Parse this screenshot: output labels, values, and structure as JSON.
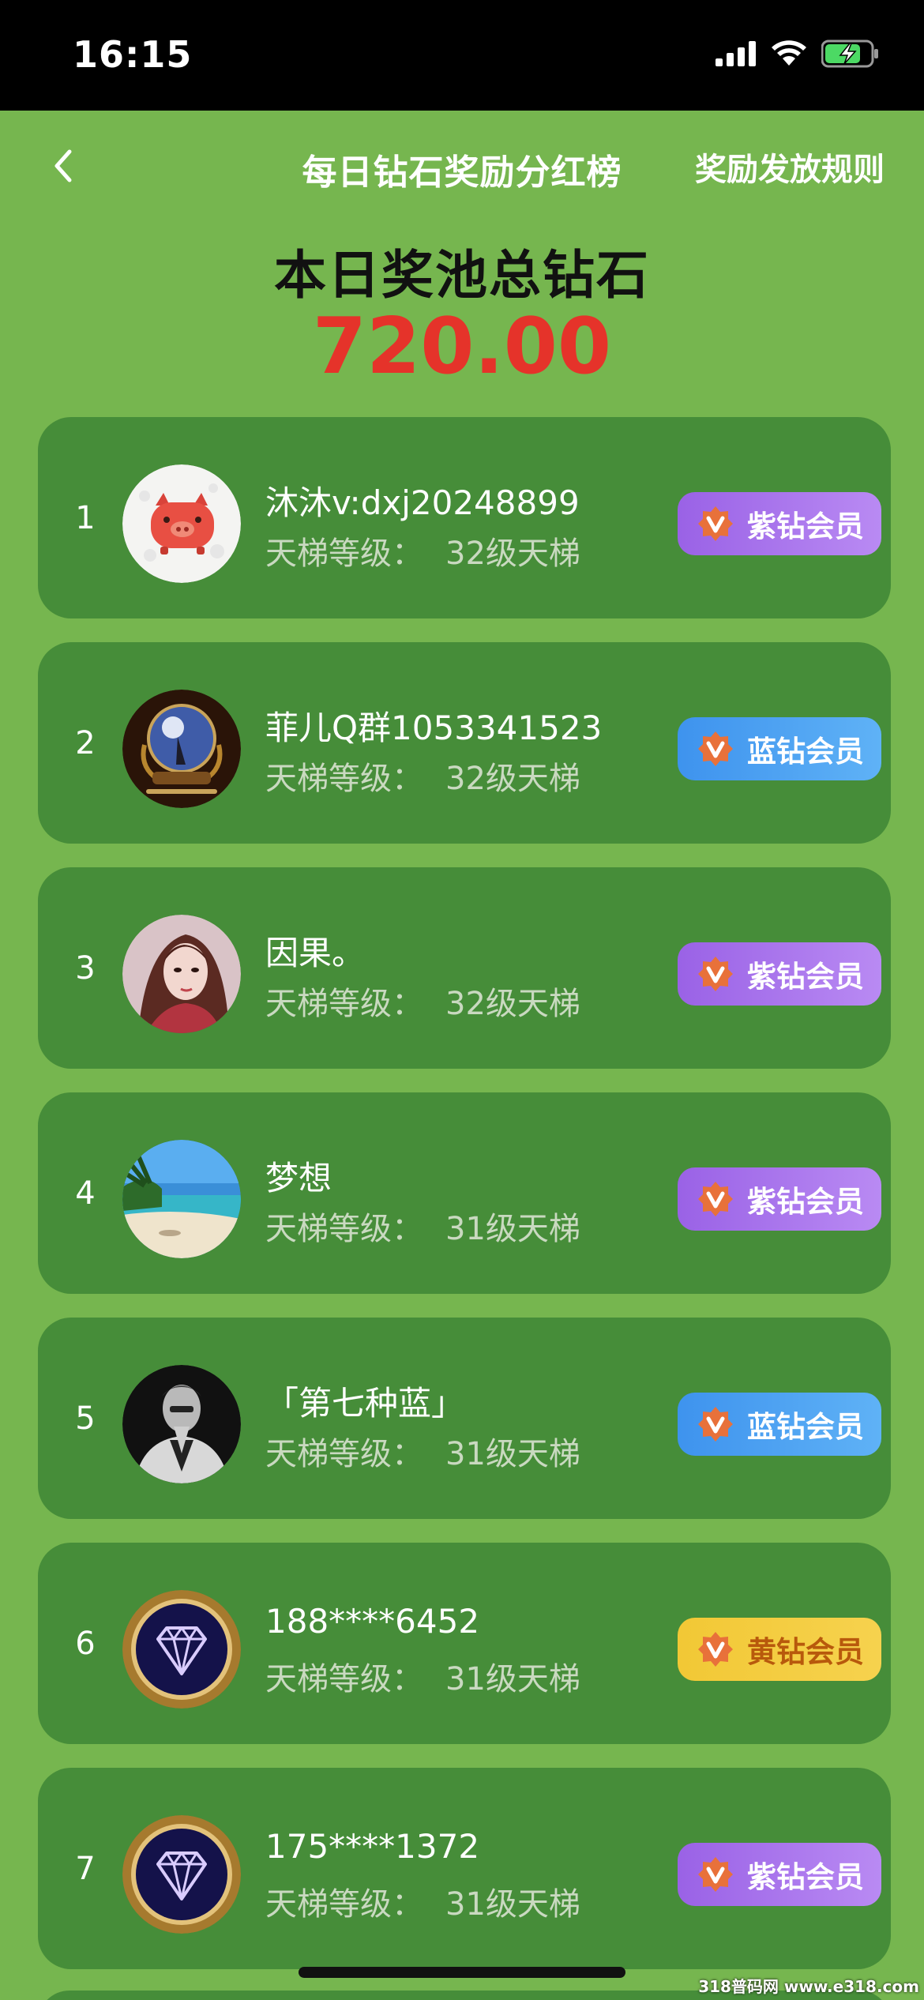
{
  "status_bar": {
    "time": "16:15"
  },
  "nav": {
    "back": "<",
    "title": "每日钻石奖励分红榜",
    "rules": "奖励发放规则"
  },
  "pool": {
    "title": "本日奖池总钻石",
    "value": "720.00"
  },
  "level_label": "天梯等级：",
  "ranking": [
    {
      "rank": "1",
      "name": "沐沐v:dxj20248899",
      "level": "32级天梯",
      "badge": "紫钻会员",
      "badge_color": "#9a62e6",
      "avatar": "pig-avatar"
    },
    {
      "rank": "2",
      "name": "菲儿Q群1053341523",
      "level": "32级天梯",
      "badge": "蓝钻会员",
      "badge_color": "#3e93ee",
      "avatar": "moon-emblem-avatar"
    },
    {
      "rank": "3",
      "name": "因果。",
      "level": "32级天梯",
      "badge": "紫钻会员",
      "badge_color": "#9a62e6",
      "avatar": "girl-portrait-avatar"
    },
    {
      "rank": "4",
      "name": "梦想",
      "level": "31级天梯",
      "badge": "紫钻会员",
      "badge_color": "#9a62e6",
      "avatar": "beach-avatar"
    },
    {
      "rank": "5",
      "name": "「第七种蓝」",
      "level": "31级天梯",
      "badge": "蓝钻会员",
      "badge_color": "#3e93ee",
      "avatar": "man-portrait-avatar"
    },
    {
      "rank": "6",
      "name": "188****6452",
      "level": "31级天梯",
      "badge": "黄钻会员",
      "badge_color": "#f2c835",
      "avatar": "diamond-avatar"
    },
    {
      "rank": "7",
      "name": "175****1372",
      "level": "31级天梯",
      "badge": "紫钻会员",
      "badge_color": "#9a62e6",
      "avatar": "diamond-avatar"
    }
  ],
  "watermark": "318普码网 www.e318.com"
}
